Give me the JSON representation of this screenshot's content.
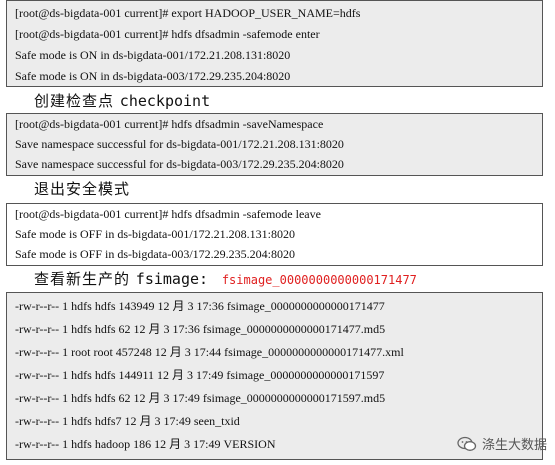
{
  "block1": {
    "lines": [
      "[root@ds-bigdata-001 current]# export HADOOP_USER_NAME=hdfs",
      "[root@ds-bigdata-001 current]# hdfs dfsadmin -safemode enter",
      "Safe mode is ON in ds-bigdata-001/172.21.208.131:8020",
      "Safe mode is ON in ds-bigdata-003/172.29.235.204:8020"
    ]
  },
  "heading1": {
    "cn": "创建检查点",
    "en": "checkpoint"
  },
  "block2": {
    "lines": [
      "[root@ds-bigdata-001 current]# hdfs dfsadmin -saveNamespace",
      "Save namespace successful for ds-bigdata-001/172.21.208.131:8020",
      "Save namespace successful for ds-bigdata-003/172.29.235.204:8020"
    ]
  },
  "heading2": {
    "cn": "退出安全模式"
  },
  "block3": {
    "lines": [
      "[root@ds-bigdata-001 current]# hdfs dfsadmin -safemode leave",
      "Safe mode is OFF in ds-bigdata-001/172.21.208.131:8020",
      "Safe mode is OFF in ds-bigdata-003/172.29.235.204:8020"
    ]
  },
  "heading3": {
    "cn": "查看新生产的",
    "en": "fsimage:",
    "file": "fsimage_0000000000000171477"
  },
  "block4": {
    "lines": [
      "-rw-r--r-- 1 hdfs hdfs 143949 12 月    3 17:36 fsimage_0000000000000171477",
      "-rw-r--r-- 1 hdfs hdfs     62 12 月    3 17:36 fsimage_0000000000000171477.md5",
      "-rw-r--r-- 1 root root 457248 12 月    3 17:44 fsimage_0000000000000171477.xml",
      "-rw-r--r-- 1 hdfs hdfs 144911 12 月    3 17:49 fsimage_0000000000000171597",
      "-rw-r--r-- 1 hdfs hdfs     62 12 月    3 17:49 fsimage_0000000000000171597.md5",
      "-rw-r--r-- 1 hdfs hdfs7 12 月    3 17:49 seen_txid",
      "-rw-r--r-- 1 hdfs hadoop    186 12 月    3 17:49 VERSION"
    ]
  },
  "watermark": {
    "text": "涤生大数据",
    "icon": "wechat-icon"
  },
  "colors": {
    "accent_red": "#e02020",
    "code_bg": "#ececec"
  }
}
